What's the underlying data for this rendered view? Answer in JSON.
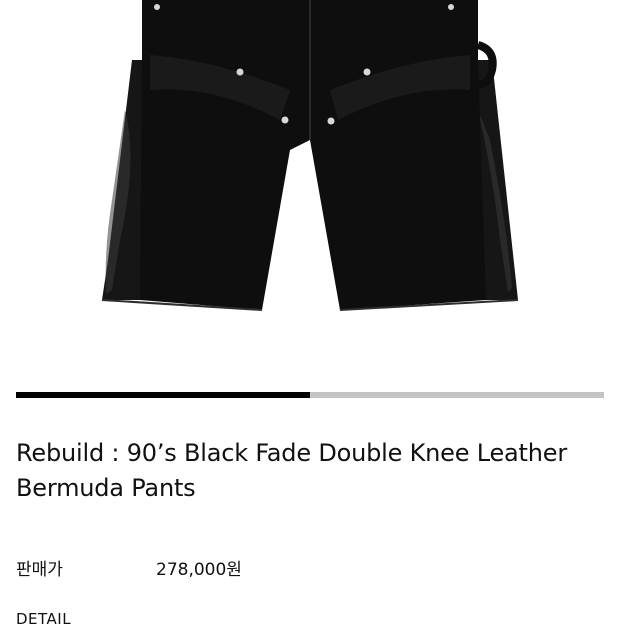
{
  "product": {
    "image_alt": "black double knee bermuda shorts with leather side panels",
    "title": "Rebuild : 90’s Black Fade Double Knee Leather Bermuda Pants",
    "price_label": "판매가",
    "price_value": "278,000원"
  },
  "gallery": {
    "progress": 0.5
  },
  "sections": {
    "detail_heading": "DETAIL"
  },
  "colors": {
    "progress_fill": "#000000",
    "progress_track": "#c4c4c4",
    "garment": "#111111",
    "leather": "#1c1c1c"
  }
}
